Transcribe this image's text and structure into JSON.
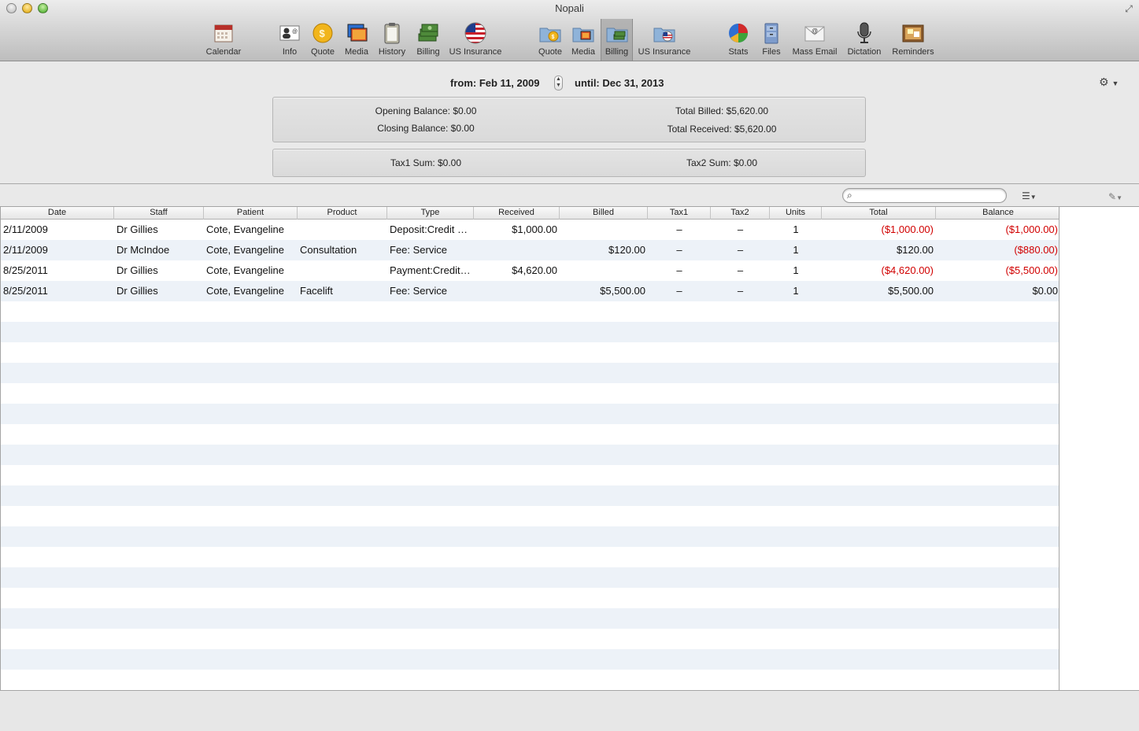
{
  "window": {
    "title": "Nopali"
  },
  "toolbar": {
    "items": [
      {
        "label": "Calendar",
        "icon": "calendar-icon"
      },
      {
        "label": "Info",
        "icon": "contact-card-icon"
      },
      {
        "label": "Quote",
        "icon": "coin-icon"
      },
      {
        "label": "Media",
        "icon": "photos-icon"
      },
      {
        "label": "History",
        "icon": "clipboard-icon"
      },
      {
        "label": "Billing",
        "icon": "money-stack-icon"
      },
      {
        "label": "US Insurance",
        "icon": "us-flag-icon"
      },
      {
        "label": "Quote",
        "icon": "folder-coin-icon"
      },
      {
        "label": "Media",
        "icon": "folder-photos-icon"
      },
      {
        "label": "Billing",
        "icon": "folder-money-icon",
        "selected": true
      },
      {
        "label": "US Insurance",
        "icon": "folder-flag-icon"
      },
      {
        "label": "Stats",
        "icon": "pie-chart-icon"
      },
      {
        "label": "Files",
        "icon": "file-cabinet-icon"
      },
      {
        "label": "Mass Email",
        "icon": "envelope-icon"
      },
      {
        "label": "Dictation",
        "icon": "microphone-icon"
      },
      {
        "label": "Reminders",
        "icon": "corkboard-icon"
      }
    ]
  },
  "filter": {
    "from_text": "from: Feb 11, 2009",
    "until_text": "until: Dec 31, 2013"
  },
  "summary": {
    "opening_balance": "Opening Balance: $0.00",
    "closing_balance": "Closing Balance: $0.00",
    "total_billed": "Total Billed: $5,620.00",
    "total_received": "Total Received: $5,620.00",
    "tax1_sum": "Tax1 Sum: $0.00",
    "tax2_sum": "Tax2 Sum: $0.00"
  },
  "search": {
    "value": "",
    "placeholder": ""
  },
  "table": {
    "columns": [
      "Date",
      "Staff",
      "Patient",
      "Product",
      "Type",
      "Received",
      "Billed",
      "Tax1",
      "Tax2",
      "Units",
      "Total",
      "Balance"
    ],
    "rows": [
      {
        "date": "2/11/2009",
        "staff": "Dr Gillies",
        "patient": "Cote, Evangeline",
        "product": "",
        "type": "Deposit:Credit Card",
        "received": "$1,000.00",
        "billed": "",
        "tax1": "–",
        "tax2": "–",
        "units": "1",
        "total": "($1,000.00)",
        "total_neg": true,
        "balance": "($1,000.00)",
        "balance_neg": true
      },
      {
        "date": "2/11/2009",
        "staff": "Dr McIndoe",
        "patient": "Cote, Evangeline",
        "product": "Consultation",
        "type": "Fee: Service",
        "received": "",
        "billed": "$120.00",
        "tax1": "–",
        "tax2": "–",
        "units": "1",
        "total": "$120.00",
        "total_neg": false,
        "balance": "($880.00)",
        "balance_neg": true
      },
      {
        "date": "8/25/2011",
        "staff": "Dr Gillies",
        "patient": "Cote, Evangeline",
        "product": "",
        "type": "Payment:Credit Card",
        "received": "$4,620.00",
        "billed": "",
        "tax1": "–",
        "tax2": "–",
        "units": "1",
        "total": "($4,620.00)",
        "total_neg": true,
        "balance": "($5,500.00)",
        "balance_neg": true
      },
      {
        "date": "8/25/2011",
        "staff": "Dr Gillies",
        "patient": "Cote, Evangeline",
        "product": "Facelift",
        "type": "Fee: Service",
        "received": "",
        "billed": "$5,500.00",
        "tax1": "–",
        "tax2": "–",
        "units": "1",
        "total": "$5,500.00",
        "total_neg": false,
        "balance": "$0.00",
        "balance_neg": false
      }
    ]
  },
  "colors": {
    "negative": "#d10000",
    "stripe": "#edf2f8"
  }
}
